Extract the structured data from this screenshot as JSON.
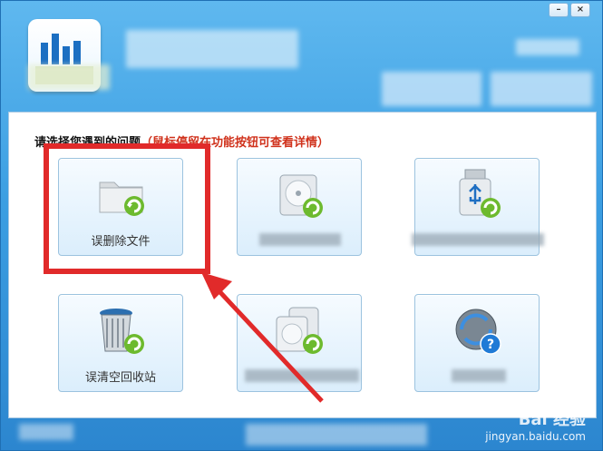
{
  "window": {
    "controls": {
      "minimize": "–",
      "close": "×"
    }
  },
  "prompt": {
    "text": "请选择您遇到的问题",
    "hint": "（鼠标停留在功能按钮可查看详情）"
  },
  "tiles": [
    {
      "label": "误删除文件",
      "icon": "folder-recover-icon"
    },
    {
      "label": "",
      "icon": "hard-drive-recover-icon"
    },
    {
      "label": "",
      "icon": "usb-drive-recover-icon"
    },
    {
      "label": "误清空回收站",
      "icon": "recycle-bin-recover-icon"
    },
    {
      "label": "",
      "icon": "multi-drive-recover-icon"
    },
    {
      "label": "",
      "icon": "disk-help-icon"
    }
  ],
  "watermark": {
    "brand": "Bai 经验",
    "url": "jingyan.baidu.com"
  },
  "colors": {
    "highlight": "#e12a2a",
    "hint": "#d0321c",
    "header": "#3b9ee2"
  }
}
